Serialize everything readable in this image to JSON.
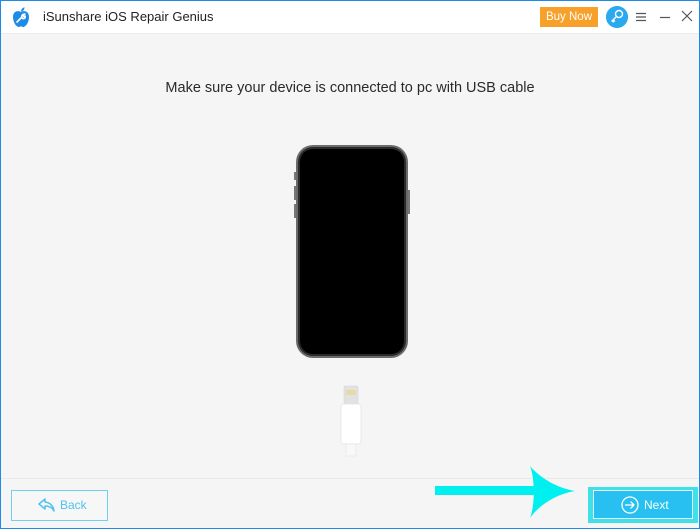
{
  "window": {
    "title": "iSunshare iOS Repair Genius",
    "buy_now_label": "Buy Now",
    "icons": {
      "logo": "apple-wrench-logo",
      "key": "key-icon",
      "menu": "hamburger-menu-icon",
      "minimize": "minimize-icon",
      "close": "close-icon"
    },
    "colors": {
      "border": "#1e8ce6",
      "buy_now": "#f7a12a",
      "accent": "#28c0f0",
      "arrow": "#00f0f0"
    }
  },
  "main": {
    "instruction": "Make sure your device is connected to pc with USB cable",
    "illustrations": [
      "iphone-illustration",
      "lightning-cable-illustration"
    ]
  },
  "footer": {
    "back_label": "Back",
    "next_label": "Next",
    "back_icon": "reply-arrow-icon",
    "next_icon": "circle-arrow-right-icon"
  }
}
